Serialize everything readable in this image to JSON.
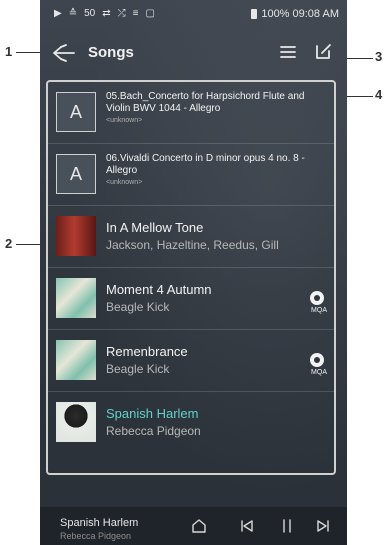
{
  "callouts": [
    "1",
    "2",
    "3",
    "4"
  ],
  "status_bar": {
    "signal": "50",
    "battery_time": "100% 09:08 AM"
  },
  "header": {
    "title": "Songs"
  },
  "songs": [
    {
      "title": "05.Bach_Concerto for Harpsichord Flute and Violin BWV 1044 - Allegro",
      "artist": "<unknown>"
    },
    {
      "title": "06.Vivaldi Concerto in D minor opus 4 no. 8 - Allegro",
      "artist": "<unknown>"
    },
    {
      "title": "In A Mellow Tone",
      "artist": "Jackson, Hazeltine, Reedus, Gill"
    },
    {
      "title": "Moment 4 Autumn",
      "artist": "Beagle Kick",
      "badge": "MQA"
    },
    {
      "title": "Remenbrance",
      "artist": "Beagle Kick",
      "badge": "MQA"
    },
    {
      "title": "Spanish Harlem",
      "artist": "Rebecca Pidgeon"
    }
  ],
  "now_playing": {
    "title": "Spanish Harlem",
    "artist": "Rebecca Pidgeon"
  },
  "colors": {
    "accent": "#63d1c7",
    "background": "#2f353d",
    "player_bar": "#1f232a"
  },
  "icons": {
    "back": "back-arrow-icon",
    "menu": "menu-lines-icon",
    "edit": "edit-icon",
    "home": "home-icon",
    "prev": "previous-icon",
    "pause": "pause-icon",
    "next": "next-icon"
  }
}
